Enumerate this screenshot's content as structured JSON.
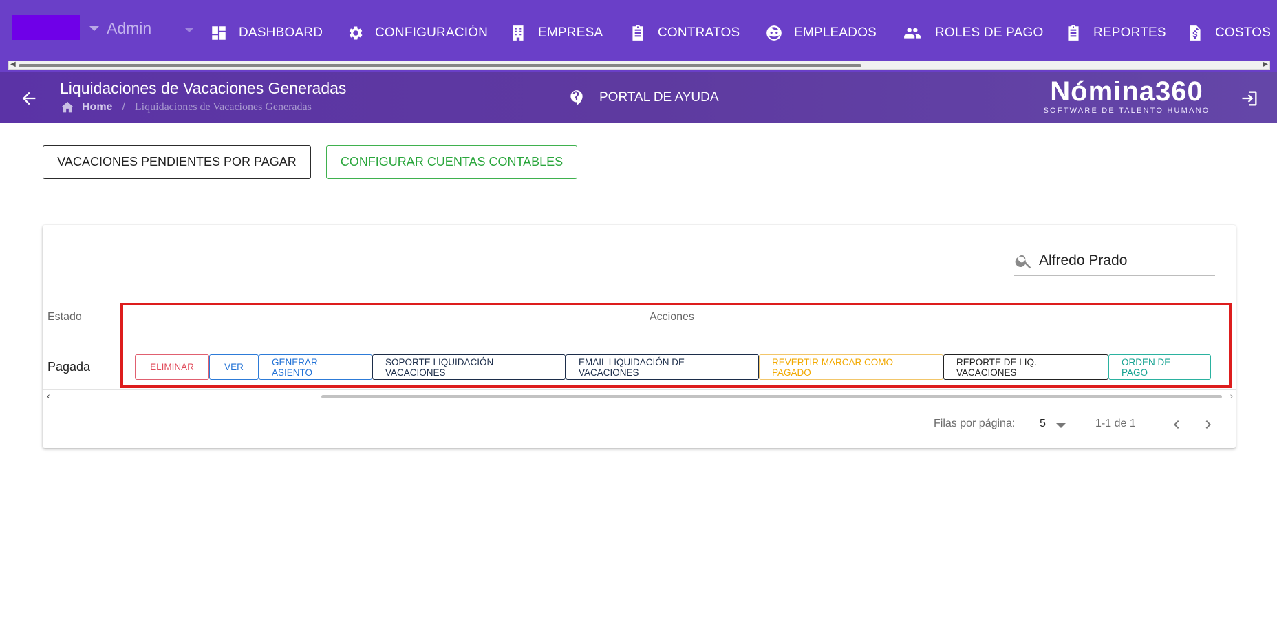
{
  "topbar": {
    "org_label": "Admin",
    "nav": [
      {
        "label": "DASHBOARD",
        "icon": "dashboard-icon"
      },
      {
        "label": "CONFIGURACIÓN",
        "icon": "gear-icon"
      },
      {
        "label": "EMPRESA",
        "icon": "building-icon"
      },
      {
        "label": "CONTRATOS",
        "icon": "clipboard-icon"
      },
      {
        "label": "EMPLEADOS",
        "icon": "face-icon"
      },
      {
        "label": "ROLES DE PAGO",
        "icon": "people-icon"
      },
      {
        "label": "REPORTES",
        "icon": "clipboard-list-icon"
      },
      {
        "label": "COSTOS",
        "icon": "dollar-file-icon"
      }
    ]
  },
  "subheader": {
    "title": "Liquidaciones de Vacaciones Generadas",
    "breadcrumb_home": "Home",
    "breadcrumb_sep": "/",
    "breadcrumb_current": "Liquidaciones de Vacaciones Generadas",
    "help_label": "PORTAL DE AYUDA",
    "brand_logo": "Nómina360",
    "brand_tagline": "SOFTWARE DE TALENTO HUMANO"
  },
  "toolbar": {
    "pending_label": "VACACIONES PENDIENTES POR PAGAR",
    "configure_label": "CONFIGURAR CUENTAS CONTABLES"
  },
  "table": {
    "search_value": "Alfredo Prado",
    "columns": {
      "estado": "Estado",
      "acciones": "Acciones"
    },
    "rows": [
      {
        "estado": "Pagada",
        "actions": {
          "delete": "ELIMINAR",
          "view": "VER",
          "generate": "GENERAR ASIENTO",
          "support": "SOPORTE LIQUIDACIÓN VACACIONES",
          "email": "EMAIL LIQUIDACIÓN DE VACACIONES",
          "revert": "REVERTIR MARCAR COMO PAGADO",
          "report": "REPORTE DE LIQ. VACACIONES",
          "order": "ORDEN DE PAGO"
        }
      }
    ],
    "footer": {
      "rows_per_page_label": "Filas por página:",
      "rows_per_page_value": "5",
      "range": "1-1 de 1"
    }
  },
  "colors": {
    "nav_bg": "#6a3fc8",
    "subheader_bg": "#5b33a6",
    "highlight": "#dd1d1d"
  }
}
